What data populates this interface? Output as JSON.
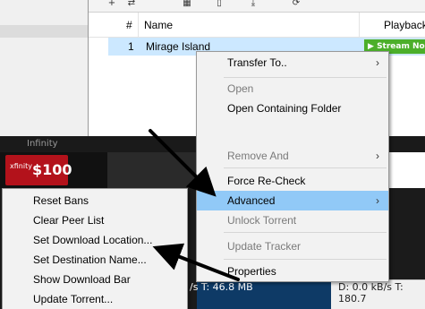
{
  "torrent_list": {
    "col_num": "#",
    "col_name": "Name",
    "col_playback": "Playback",
    "row": {
      "num": "1",
      "name": "Mirage Island",
      "stream_label": "Stream No"
    }
  },
  "ad": {
    "header_text": "Infinity",
    "brand": "xfinity",
    "price": "$100"
  },
  "status": {
    "left": "/s T: 46.8 MB",
    "right": "D: 0.0 kB/s T: 180.7"
  },
  "context_menu": {
    "items": [
      {
        "label": "Transfer To..",
        "disabled": false,
        "submenu": true
      },
      {
        "label": "Open",
        "disabled": true
      },
      {
        "label": "Open Containing Folder",
        "disabled": false
      },
      {
        "label": "Remove And",
        "disabled": true,
        "submenu": true
      },
      {
        "label": "Force Re-Check",
        "disabled": false
      },
      {
        "label": "Advanced",
        "disabled": false,
        "submenu": true,
        "highlighted": true
      },
      {
        "label": "Unlock Torrent",
        "disabled": true
      },
      {
        "label": "Update Tracker",
        "disabled": true
      },
      {
        "label": "Properties",
        "disabled": false
      }
    ],
    "submenu_arrow": "›"
  },
  "advanced_submenu": {
    "items": [
      {
        "label": "Reset Bans"
      },
      {
        "label": "Clear Peer List"
      },
      {
        "label": "Set Download Location..."
      },
      {
        "label": "Set Destination Name..."
      },
      {
        "label": "Show Download Bar"
      },
      {
        "label": "Update Torrent..."
      }
    ]
  },
  "colors": {
    "highlight": "#91c9f7",
    "selection": "#cce8ff",
    "stream_green": "#4caf2a",
    "arrow": "#000000"
  }
}
